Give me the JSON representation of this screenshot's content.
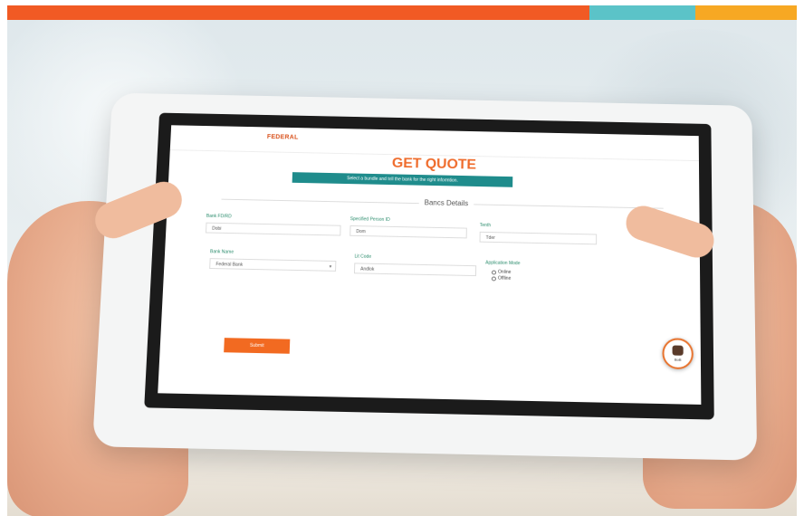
{
  "topbar": {
    "colors": [
      "#f15a24",
      "#5bc3c8",
      "#f7a823"
    ]
  },
  "app": {
    "logo": "FEDERAL",
    "logo_tagline": "",
    "header_info_line1": "",
    "header_info_line2": "",
    "title": "GET QUOTE",
    "banner": "Select a bundle and tell the bank for the right informtion.",
    "section_label": "Bancs Details",
    "fields": {
      "field1_label": "Bank FD/RD",
      "field1_value": "Dobi",
      "field2_label": "Specified Person ID",
      "field2_value": "Dom",
      "field3_label": "Tenth",
      "field3_value": "Tder",
      "field4_label": "Bank Name",
      "field4_value": "Federal Bank",
      "field5_label": "Lit Code",
      "field5_value": "Andlok",
      "field6_label": "Application Mode"
    },
    "radio_options": [
      "Online",
      "Offline"
    ],
    "submit_label": "Submit",
    "bot_label": "BoB"
  }
}
